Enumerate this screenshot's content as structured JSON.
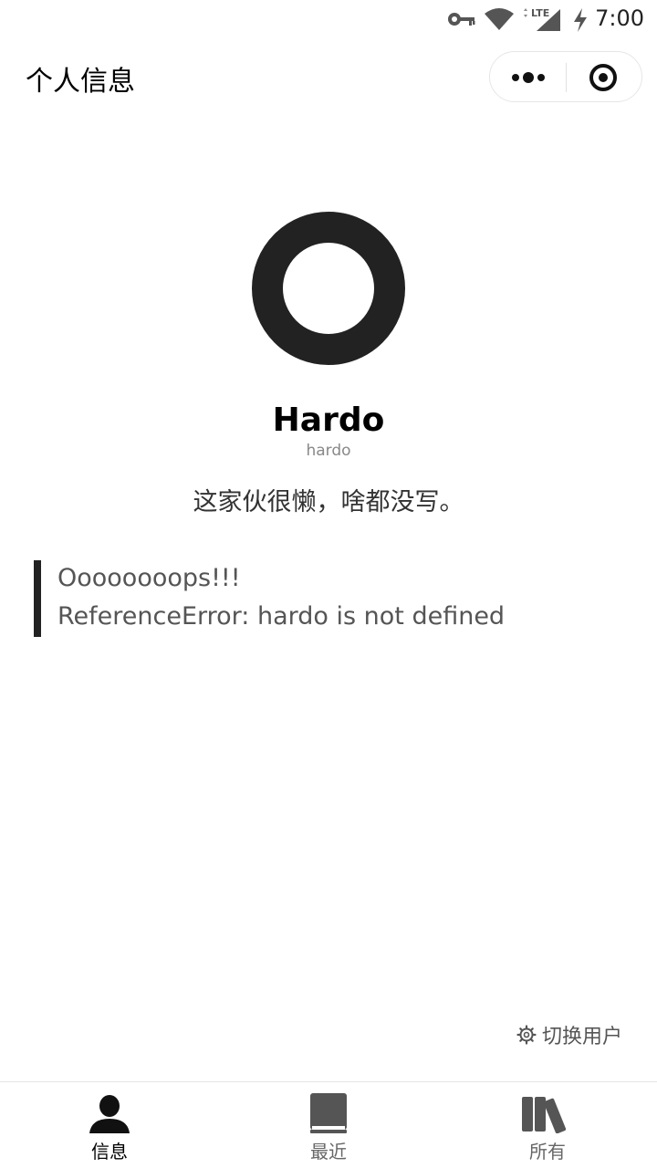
{
  "status_bar": {
    "time": "7:00",
    "network_label": "LTE",
    "icons": [
      "key-icon",
      "wifi-icon",
      "lte-signal-icon",
      "battery-charging-icon"
    ]
  },
  "header": {
    "title": "个人信息",
    "capsule_icons": [
      "more-dots-icon",
      "close-target-icon"
    ]
  },
  "profile": {
    "display_name": "Hardo",
    "username": "hardo",
    "bio": "这家伙很懒，啥都没写。"
  },
  "error": {
    "title": "Oooooooops!!!",
    "message": "ReferenceError: hardo is not defined"
  },
  "switch_user": {
    "label": "切换用户",
    "icon": "gear-icon"
  },
  "tab_bar": {
    "tabs": [
      {
        "label": "信息",
        "icon": "person-icon",
        "active": true
      },
      {
        "label": "最近",
        "icon": "book-icon",
        "active": false
      },
      {
        "label": "所有",
        "icon": "books-icon",
        "active": false
      }
    ]
  },
  "colors": {
    "primary_dark": "#222222",
    "text_secondary": "#555555",
    "background": "#ffffff"
  }
}
